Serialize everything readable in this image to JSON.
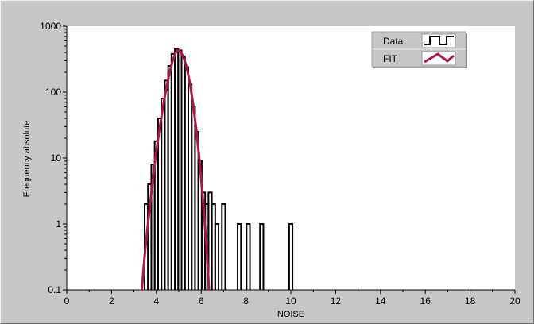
{
  "chart_data": {
    "type": "line",
    "xlabel": "NOISE",
    "ylabel": "Frequency absolute",
    "xlim": [
      0,
      20
    ],
    "ylim": [
      0.1,
      1000
    ],
    "yscale": "log",
    "grid": false,
    "legend_position": "top-right",
    "xticks": [
      "0",
      "2",
      "4",
      "6",
      "8",
      "10",
      "12",
      "14",
      "16",
      "18",
      "20"
    ],
    "yticks": [
      {
        "value": 0.1,
        "label": "0.1"
      },
      {
        "value": 1,
        "label": "1"
      },
      {
        "value": 10,
        "label": "10"
      },
      {
        "value": 100,
        "label": "100"
      },
      {
        "value": 1000,
        "label": "1000"
      }
    ],
    "series": [
      {
        "name": "Data",
        "style": "step",
        "color": "#000000",
        "bin_width": 0.15,
        "points": [
          {
            "x": 3.55,
            "y": 2
          },
          {
            "x": 3.7,
            "y": 4
          },
          {
            "x": 3.85,
            "y": 8
          },
          {
            "x": 4.0,
            "y": 18
          },
          {
            "x": 4.15,
            "y": 40
          },
          {
            "x": 4.3,
            "y": 80
          },
          {
            "x": 4.45,
            "y": 150
          },
          {
            "x": 4.6,
            "y": 250
          },
          {
            "x": 4.75,
            "y": 380
          },
          {
            "x": 4.9,
            "y": 450
          },
          {
            "x": 5.05,
            "y": 430
          },
          {
            "x": 5.2,
            "y": 350
          },
          {
            "x": 5.35,
            "y": 240
          },
          {
            "x": 5.5,
            "y": 130
          },
          {
            "x": 5.65,
            "y": 60
          },
          {
            "x": 5.8,
            "y": 25
          },
          {
            "x": 5.95,
            "y": 9
          },
          {
            "x": 6.1,
            "y": 3
          },
          {
            "x": 6.25,
            "y": 2
          },
          {
            "x": 6.4,
            "y": 3
          },
          {
            "x": 6.55,
            "y": 2
          },
          {
            "x": 6.7,
            "y": 1
          },
          {
            "x": 7.0,
            "y": 2
          },
          {
            "x": 7.7,
            "y": 1
          },
          {
            "x": 8.1,
            "y": 1
          },
          {
            "x": 8.7,
            "y": 1
          },
          {
            "x": 10.0,
            "y": 1
          }
        ]
      },
      {
        "name": "FIT",
        "style": "line",
        "color": "#b0154a",
        "points": [
          {
            "x": 3.35,
            "y": 0.1
          },
          {
            "x": 3.5,
            "y": 0.4
          },
          {
            "x": 3.65,
            "y": 1.2
          },
          {
            "x": 3.8,
            "y": 3.5
          },
          {
            "x": 3.95,
            "y": 9.5
          },
          {
            "x": 4.1,
            "y": 22
          },
          {
            "x": 4.25,
            "y": 48
          },
          {
            "x": 4.4,
            "y": 95
          },
          {
            "x": 4.55,
            "y": 170
          },
          {
            "x": 4.7,
            "y": 280
          },
          {
            "x": 4.85,
            "y": 390
          },
          {
            "x": 4.95,
            "y": 430
          },
          {
            "x": 5.05,
            "y": 420
          },
          {
            "x": 5.2,
            "y": 350
          },
          {
            "x": 5.35,
            "y": 240
          },
          {
            "x": 5.5,
            "y": 135
          },
          {
            "x": 5.65,
            "y": 62
          },
          {
            "x": 5.8,
            "y": 24
          },
          {
            "x": 5.95,
            "y": 7.5
          },
          {
            "x": 6.1,
            "y": 1.9
          },
          {
            "x": 6.25,
            "y": 0.4
          },
          {
            "x": 6.35,
            "y": 0.1
          }
        ]
      }
    ]
  }
}
